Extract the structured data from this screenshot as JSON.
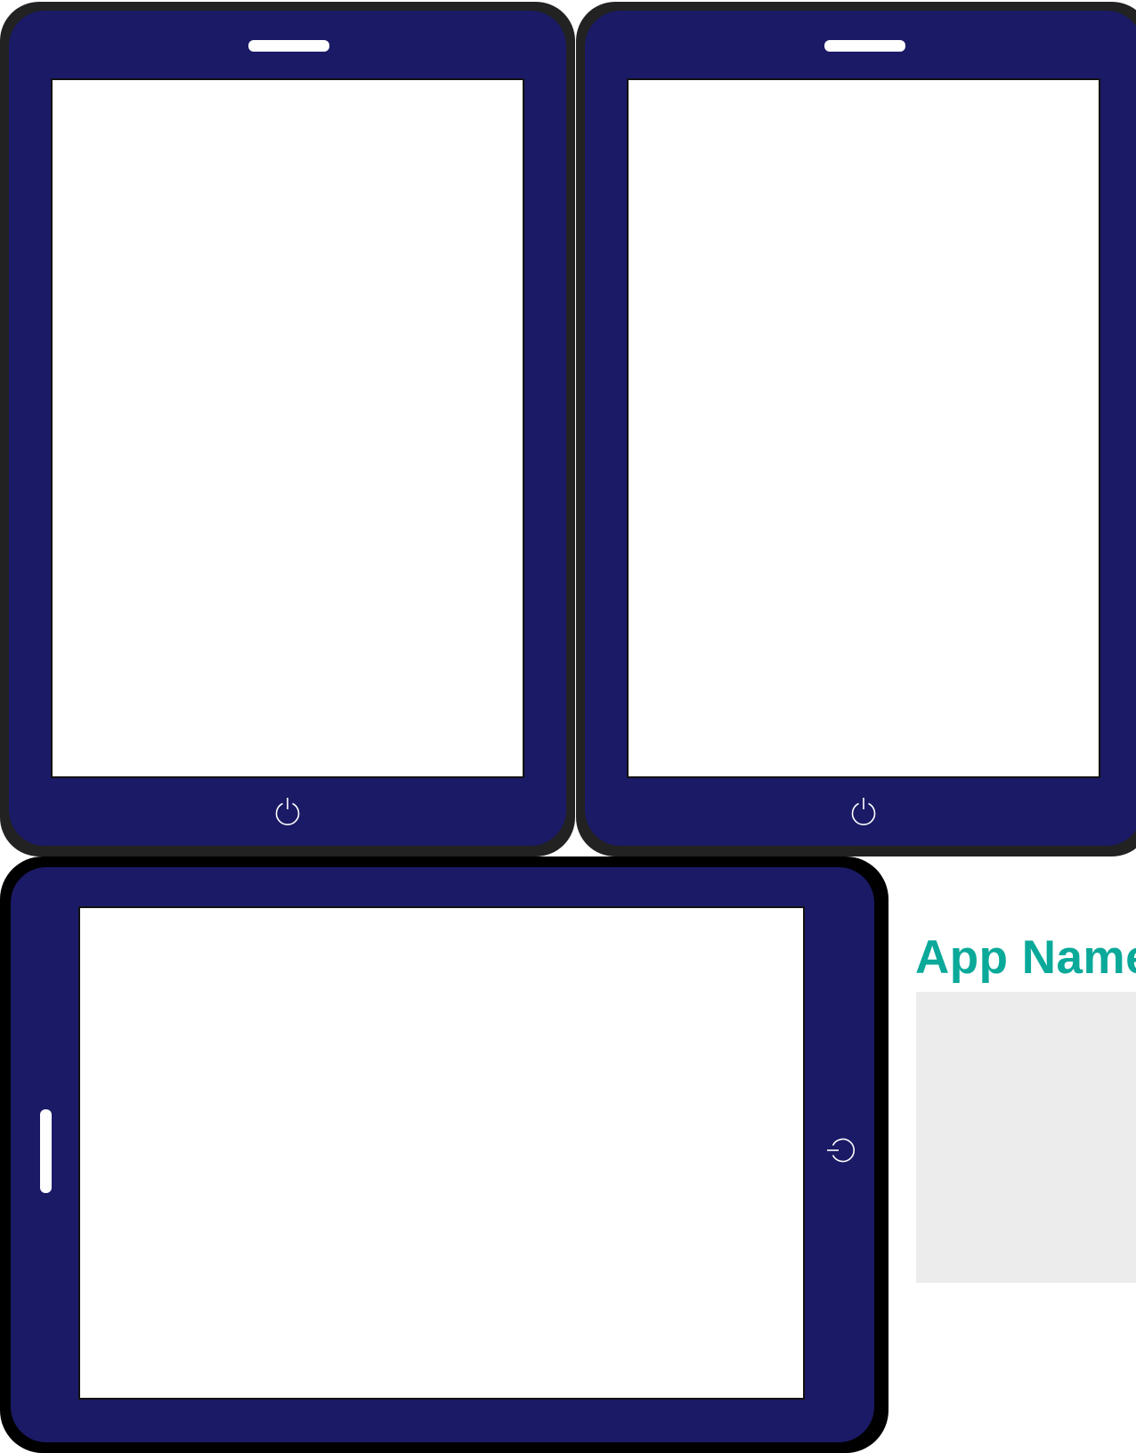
{
  "app": {
    "title": "App Name"
  },
  "colors": {
    "bezel": "#1b1a66",
    "frame_dark": "#222222",
    "frame_black": "#000000",
    "screen": "#ffffff",
    "accent": "#0aa99a",
    "preview_bg": "#ececec"
  },
  "devices": [
    {
      "id": "tablet-portrait-1",
      "orientation": "portrait",
      "icons": [
        "speaker-slot",
        "power-icon"
      ]
    },
    {
      "id": "tablet-portrait-2",
      "orientation": "portrait",
      "icons": [
        "speaker-slot",
        "power-icon"
      ]
    },
    {
      "id": "tablet-landscape",
      "orientation": "landscape",
      "icons": [
        "speaker-slot",
        "power-icon"
      ]
    }
  ]
}
